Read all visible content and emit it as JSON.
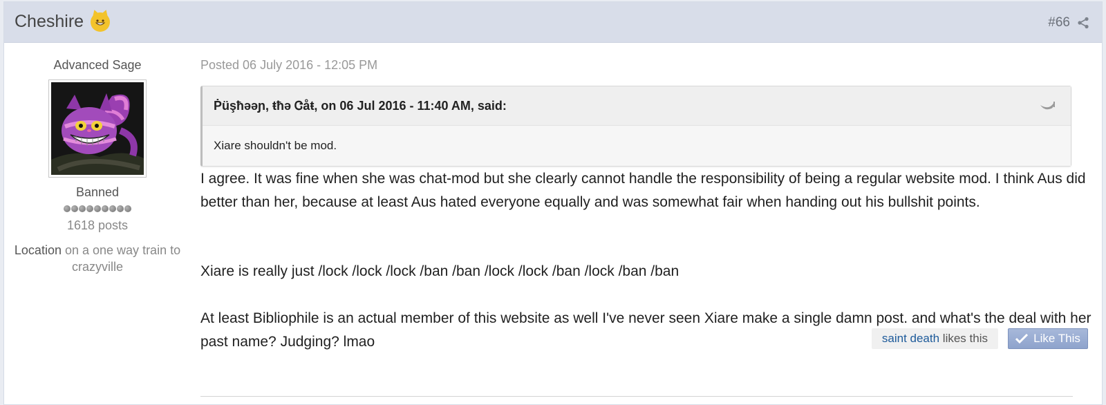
{
  "header": {
    "author": "Cheshire",
    "emoji_icon": "grinning-cat-icon",
    "post_number": "#66",
    "share_icon": "share-icon"
  },
  "sidebar": {
    "rank_title": "Advanced Sage",
    "avatar_icon": "cheshire-cat-avatar",
    "group": "Banned",
    "pip_count": 9,
    "post_count": "1618 posts",
    "location_label": "Location",
    "location_value": "on a one way train to crazyville"
  },
  "post": {
    "posted": "Posted 06 July 2016 - 12:05 PM",
    "quote": {
      "citation": "Ṗüşħəəɲ, ŧħə Ꮳåŧ, on 06 Jul 2016 - 11:40 AM, said:",
      "text": "Xiare shouldn't be mod.",
      "jump_icon": "quote-jump-icon"
    },
    "paragraphs": [
      "I agree. It was fine when she was chat-mod but she clearly cannot handle the responsibility of being a regular website mod. I think Aus did better than her, because at least Aus hated everyone equally and was somewhat fair when handing out his bullshit points.",
      "Xiare is really just /lock /lock /lock /ban /ban /lock /lock /ban /lock /ban /ban",
      "At least Bibliophile is an actual member of this website as well I've never seen Xiare make a single damn post. and what's the deal with her past name? Judging? lmao"
    ]
  },
  "likes": {
    "liker": "saint death",
    "suffix": " likes this",
    "button_label": "Like This",
    "button_icon": "check-icon"
  },
  "colors": {
    "header_bg": "#d8dde9",
    "link": "#1d5a9a",
    "like_button": "#95a8d0"
  }
}
